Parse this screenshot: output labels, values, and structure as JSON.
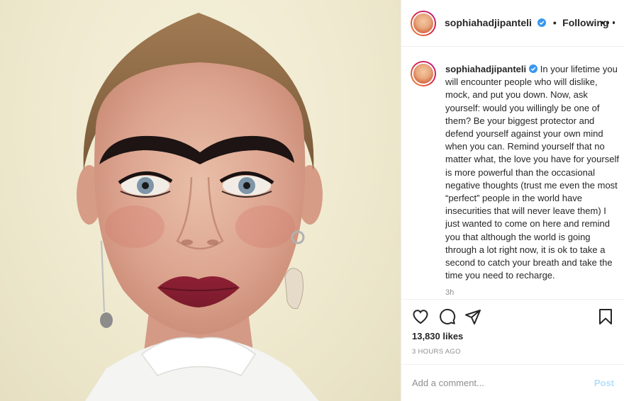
{
  "post": {
    "author": {
      "username": "sophiahadjipanteli",
      "verified": true,
      "follow_status": "Following",
      "separator": "•"
    },
    "photo": {
      "subject": "portrait"
    },
    "caption": {
      "text": "In your lifetime you will encounter people who will dislike, mock, and put you down. Now, ask yourself: would you willingly be one of them? Be your biggest protector and defend yourself against your own mind when you can. Remind yourself that no matter what, the love you have for yourself is more powerful than the occasional negative thoughts (trust me even the most “perfect” people in the world have insecurities that will never leave them) I just wanted to come on here and remind you that although the world is going through a lot right now, it is ok to take a second to catch your breath and take the time you need to recharge.",
      "relative_time": "3h"
    },
    "actions": {
      "like_icon": "heart-icon",
      "comment_icon": "comment-icon",
      "share_icon": "share-icon",
      "save_icon": "bookmark-icon"
    },
    "likes_text": "13,830 likes",
    "timestamp": "3 HOURS AGO",
    "comment": {
      "placeholder": "Add a comment...",
      "value": "",
      "post_label": "Post"
    },
    "colors": {
      "verified_blue": "#3897f0",
      "post_button_disabled": "#b2dffc",
      "secondary_text": "#8e8e8e",
      "avatar_ring_start": "#f09433",
      "avatar_ring_end": "#bc1888"
    }
  }
}
